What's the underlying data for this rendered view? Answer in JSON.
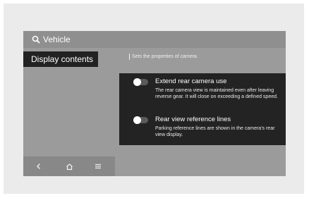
{
  "header": {
    "title": "Vehicle",
    "search_icon": "search-icon"
  },
  "sidebar": {
    "items": [
      {
        "label": "Display contents",
        "selected": true
      }
    ]
  },
  "bottom_nav": [
    {
      "name": "back",
      "glyph": "<"
    },
    {
      "name": "home",
      "glyph": "⌂"
    },
    {
      "name": "menu",
      "glyph": "≡"
    }
  ],
  "main": {
    "hint": "Sets the properties of camera.",
    "settings": [
      {
        "title": "Extend rear camera use",
        "description": "The rear camera view is maintained even after leaving reverse gear. It will close on exceeding a defined speed.",
        "enabled": false
      },
      {
        "title": "Rear view reference lines",
        "description": "Parking reference lines are shown in the camera's rear view display.",
        "enabled": false
      }
    ]
  },
  "colors": {
    "background": "#9b9b9b",
    "panel": "#232323",
    "selected_item": "#222222",
    "text": "#ffffff"
  }
}
